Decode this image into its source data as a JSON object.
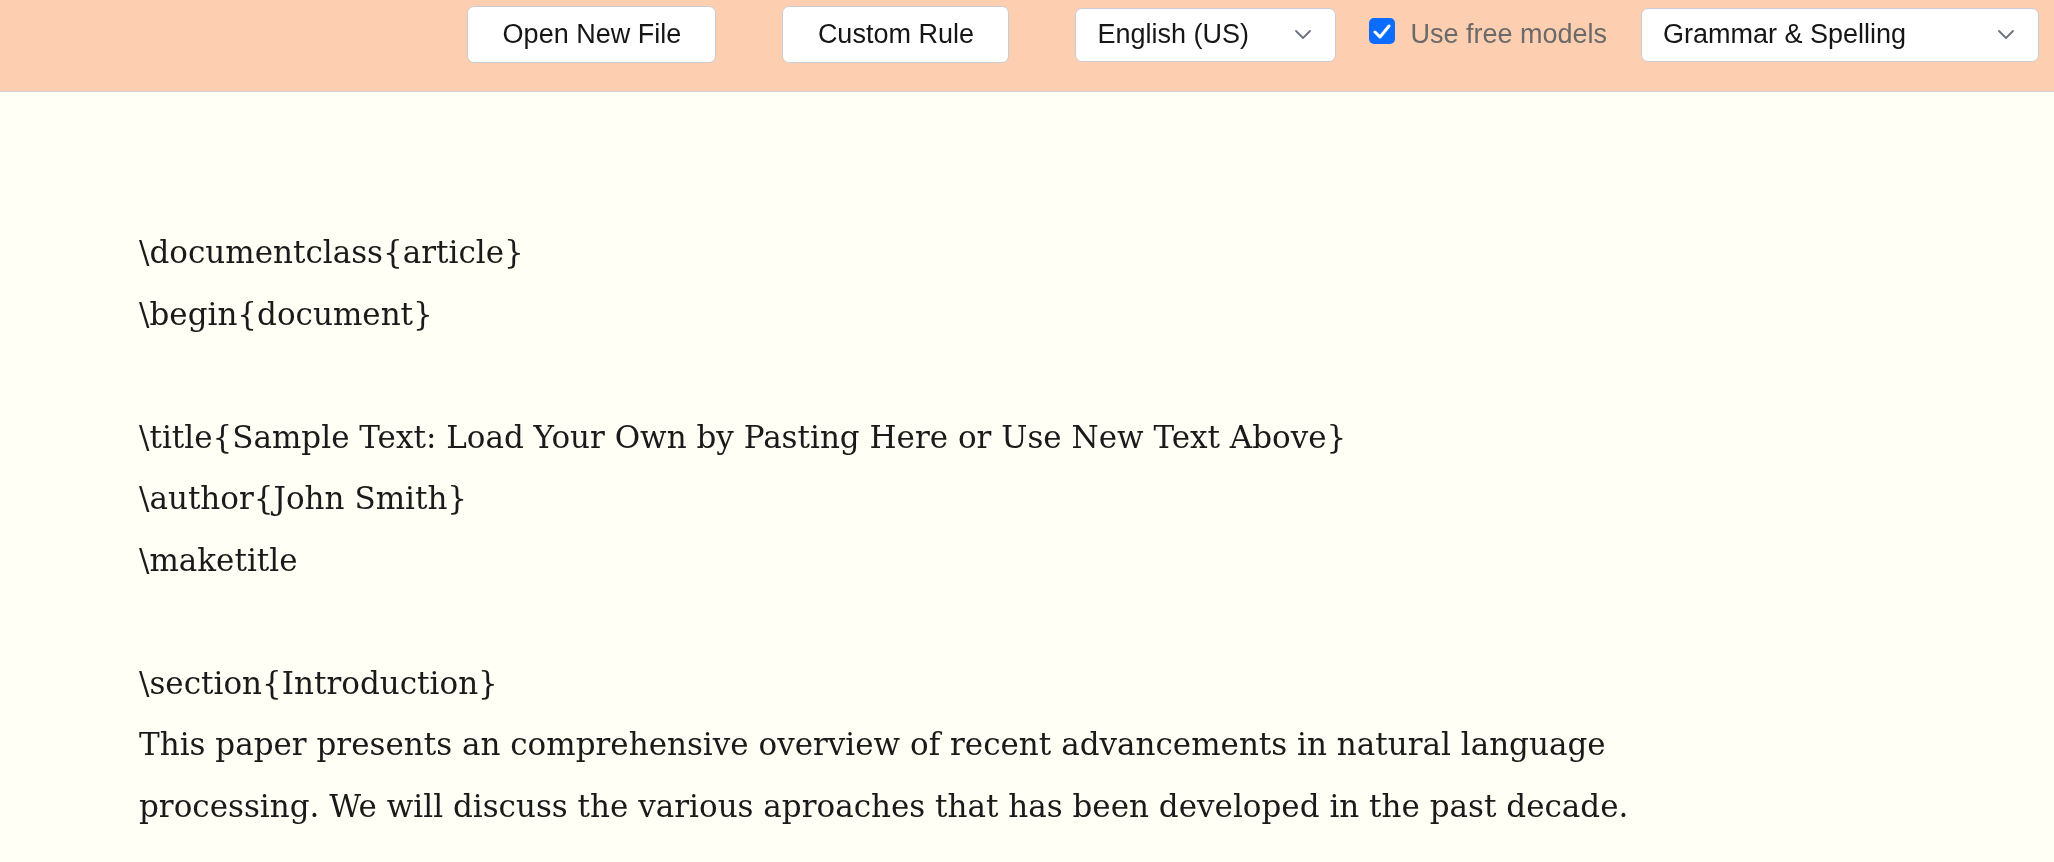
{
  "toolbar": {
    "buttons": [
      {
        "label": "Open New File"
      },
      {
        "label": "Custom Rule"
      }
    ],
    "language_select": {
      "value": "English (US)"
    },
    "free_models": {
      "label": "Use free models",
      "checked": true
    },
    "mode_select": {
      "value": "Grammar & Spelling"
    }
  },
  "editor": {
    "blocks": [
      {
        "lines": [
          "\\documentclass{article}",
          "\\begin{document}"
        ]
      },
      {
        "lines": [
          "\\title{Sample Text: Load Your Own by Pasting Here or Use New Text Above}",
          "\\author{John Smith}",
          "\\maketitle"
        ]
      },
      {
        "lines": [
          "\\section{Introduction}",
          "This paper presents an comprehensive overview of recent advancements in natural language processing. We will discuss the various aproaches that has been developed in the past decade."
        ]
      }
    ]
  }
}
